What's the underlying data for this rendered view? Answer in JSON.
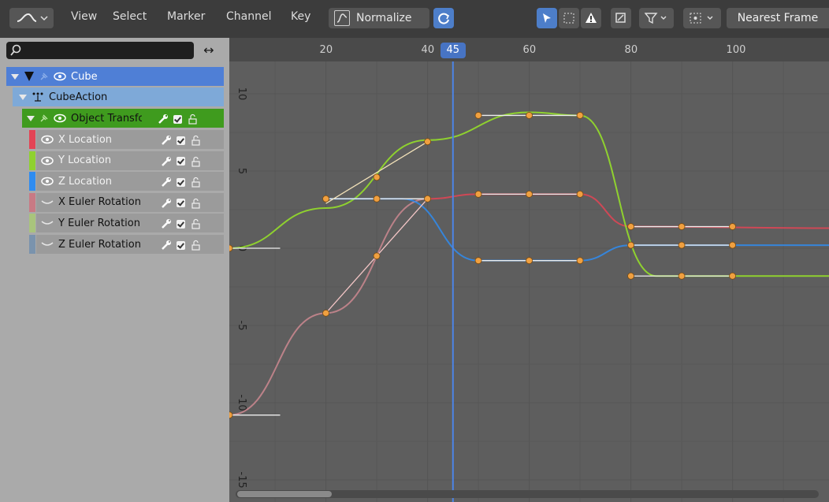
{
  "header": {
    "menus": [
      "View",
      "Select",
      "Marker",
      "Channel",
      "Key"
    ],
    "normalize_label": "Normalize",
    "snap_mode": "Nearest Frame"
  },
  "channels": {
    "search_placeholder": "",
    "rows": [
      {
        "label": "Cube",
        "color": "#4f7fd6"
      },
      {
        "label": "CubeAction",
        "color": "#7ea9d8"
      },
      {
        "label": "Object Transforms",
        "color": "#3f9b1e"
      },
      {
        "label": "X Location",
        "color": "#e34455"
      },
      {
        "label": "Y Location",
        "color": "#8fd12f"
      },
      {
        "label": "Z Location",
        "color": "#2f8cf0"
      },
      {
        "label": "X Euler Rotation",
        "color": "#c87a84"
      },
      {
        "label": "Y Euler Rotation",
        "color": "#a9c47c"
      },
      {
        "label": "Z Euler Rotation",
        "color": "#7a93ad"
      }
    ]
  },
  "graph": {
    "current_frame": "45",
    "x_ticks": [
      "20",
      "40",
      "60",
      "80",
      "100"
    ],
    "y_ticks": [
      "10",
      "5",
      "0",
      "-5",
      "-10",
      "-15"
    ],
    "colors": {
      "x_location": "#e34455",
      "y_location": "#8fd12f",
      "z_location": "#2f8cf0",
      "x_rot": "#d38b93",
      "keyframe": "#f0a040",
      "cursor": "#4c84e6"
    }
  }
}
